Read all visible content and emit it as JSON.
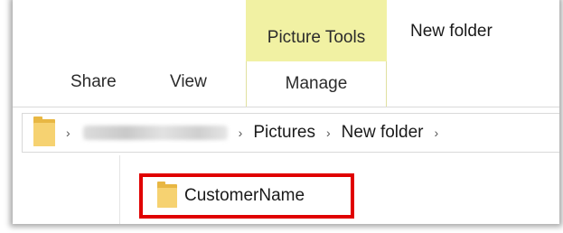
{
  "ribbon": {
    "context_group_title": "Picture Tools",
    "context_tab_label": "Manage",
    "window_title": "New folder",
    "tabs": [
      {
        "label": "Share"
      },
      {
        "label": "View"
      }
    ]
  },
  "address_bar": {
    "root_icon": "folder-icon",
    "crumbs": [
      "Pictures",
      "New folder"
    ],
    "redacted_segment": true
  },
  "content": {
    "items": [
      {
        "label": "CustomerName",
        "icon": "folder-icon",
        "highlight_color": "#e00000"
      }
    ]
  },
  "colors": {
    "context_header_bg": "#f1f1a3",
    "folder": "#f6d271"
  }
}
